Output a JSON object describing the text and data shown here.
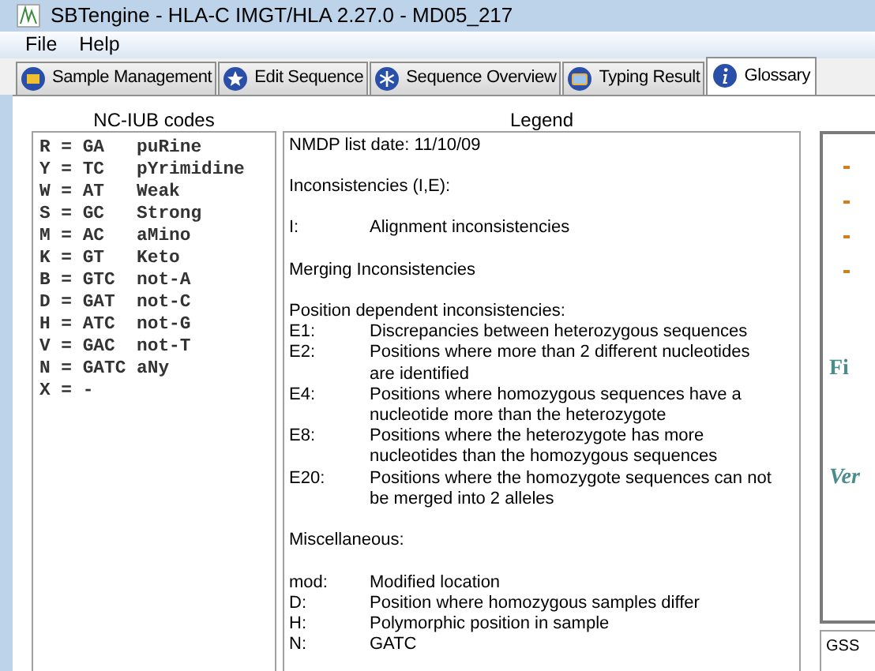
{
  "window": {
    "title": "SBTengine - HLA-C IMGT/HLA 2.27.0 - MD05_217"
  },
  "menu": [
    "File",
    "Help"
  ],
  "tabs": [
    {
      "label": "Sample Management",
      "selected": false
    },
    {
      "label": "Edit Sequence",
      "selected": false
    },
    {
      "label": "Sequence Overview",
      "selected": false
    },
    {
      "label": "Typing Result",
      "selected": false
    },
    {
      "label": "Glossary",
      "selected": true
    }
  ],
  "codes_panel": {
    "title": "NC-IUB codes",
    "lines": [
      "R = GA   puRine",
      "Y = TC   pYrimidine",
      "W = AT   Weak",
      "S = GC   Strong",
      "M = AC   aMino",
      "K = GT   Keto",
      "B = GTC  not-A",
      "D = GAT  not-C",
      "H = ATC  not-G",
      "V = GAC  not-T",
      "N = GATC aNy",
      "X = -"
    ]
  },
  "legend_panel": {
    "title": "Legend",
    "items": [
      {
        "kind": "line",
        "text": "NMDP list date: 11/10/09"
      },
      {
        "kind": "blank"
      },
      {
        "kind": "line",
        "text": "Inconsistencies (I,E):"
      },
      {
        "kind": "blank"
      },
      {
        "kind": "entry",
        "code": "I:",
        "text_lines": [
          "Alignment inconsistencies"
        ]
      },
      {
        "kind": "blank"
      },
      {
        "kind": "line",
        "text": "Merging Inconsistencies"
      },
      {
        "kind": "blank"
      },
      {
        "kind": "line",
        "text": "Position dependent inconsistencies:"
      },
      {
        "kind": "entry",
        "code": "E1:",
        "text_lines": [
          "Discrepancies between heterozygous sequences"
        ]
      },
      {
        "kind": "entry",
        "code": "E2:",
        "text_lines": [
          "Positions where more than 2 different nucleotides",
          "are identified"
        ]
      },
      {
        "kind": "entry",
        "code": "E4:",
        "text_lines": [
          "Positions where homozygous sequences have a",
          "nucleotide more than the heterozygote"
        ]
      },
      {
        "kind": "entry",
        "code": "E8:",
        "text_lines": [
          "Positions where the heterozygote has more",
          "nucleotides than the homozygous sequences"
        ]
      },
      {
        "kind": "entry",
        "code": "E20:",
        "text_lines": [
          "Positions where the homozygote sequences can not",
          "be merged into 2 alleles"
        ]
      },
      {
        "kind": "blank"
      },
      {
        "kind": "line",
        "text": "Miscellaneous:"
      },
      {
        "kind": "blank"
      },
      {
        "kind": "entry",
        "code": "mod:",
        "text_lines": [
          "Modified location"
        ]
      },
      {
        "kind": "entry",
        "code": "D:",
        "text_lines": [
          "Position where homozygous samples differ"
        ]
      },
      {
        "kind": "entry",
        "code": "H:",
        "text_lines": [
          "Polymorphic position in sample"
        ]
      },
      {
        "kind": "entry",
        "code": "N:",
        "text_lines": [
          "GATC"
        ]
      }
    ]
  },
  "side_panel": {
    "texts": [
      {
        "text": "Fi",
        "kind": "bold"
      },
      {
        "text": "Ver",
        "kind": "italic"
      }
    ],
    "field": "GSS"
  }
}
